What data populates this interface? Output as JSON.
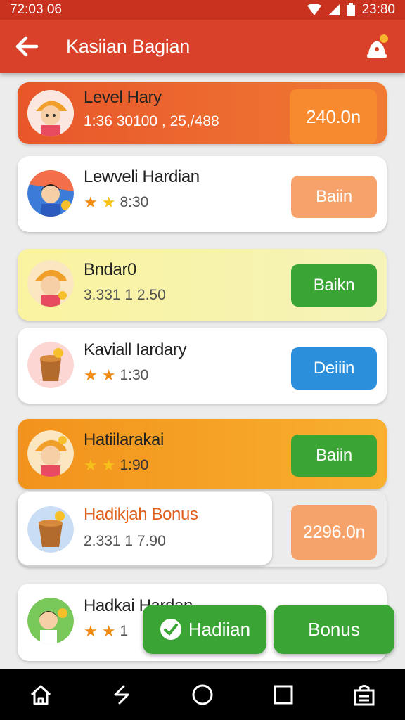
{
  "status": {
    "time_left": "72:03 06",
    "time_right": "23:80"
  },
  "header": {
    "title": "Kasiian Bagian"
  },
  "items": [
    {
      "name": "Level Hary",
      "sub": "1:36  30100 , 25,/488",
      "button": "240.0n"
    },
    {
      "name": "Lewveli Hardian",
      "sub": "8:30",
      "button": "Baiin"
    },
    {
      "name": "Bndar0",
      "sub": "3.331 1 2.50",
      "button": "Baikn"
    },
    {
      "name": "Kaviall Iardary",
      "sub": "1:30",
      "button": "Deiiin"
    },
    {
      "name": "Hatiilarakai",
      "sub": "1:90",
      "button": "Baiin"
    },
    {
      "name": "Hadikjah Bonus",
      "sub": "2.331 1 7.90",
      "button": "2296.0n"
    },
    {
      "name": "Hadkai Hardan",
      "sub": "1"
    }
  ],
  "fabs": {
    "left": "Hadiian",
    "right": "Bonus"
  },
  "colors": {
    "appbar": "#d9412a",
    "orange": "#ee6c2c",
    "green": "#3aa535",
    "blue": "#2b8fdc",
    "peach": "#f6a26a"
  }
}
